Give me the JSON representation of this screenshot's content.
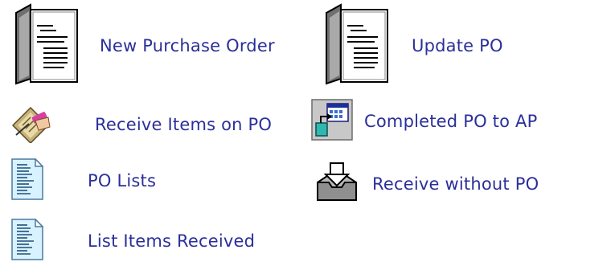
{
  "menu": {
    "items": [
      {
        "label": "New Purchase Order",
        "icon": "binder-document-icon"
      },
      {
        "label": "Update PO",
        "icon": "binder-document-icon"
      },
      {
        "label": "Receive Items on PO",
        "icon": "hand-signing-form-icon"
      },
      {
        "label": "Completed PO to AP",
        "icon": "transfer-to-window-icon"
      },
      {
        "label": "PO Lists",
        "icon": "text-document-icon"
      },
      {
        "label": "Receive without PO",
        "icon": "inbox-tray-icon"
      },
      {
        "label": "List Items Received",
        "icon": "text-document-icon"
      }
    ]
  },
  "colors": {
    "link_text": "#2b2f9a",
    "background": "#ffffff"
  }
}
